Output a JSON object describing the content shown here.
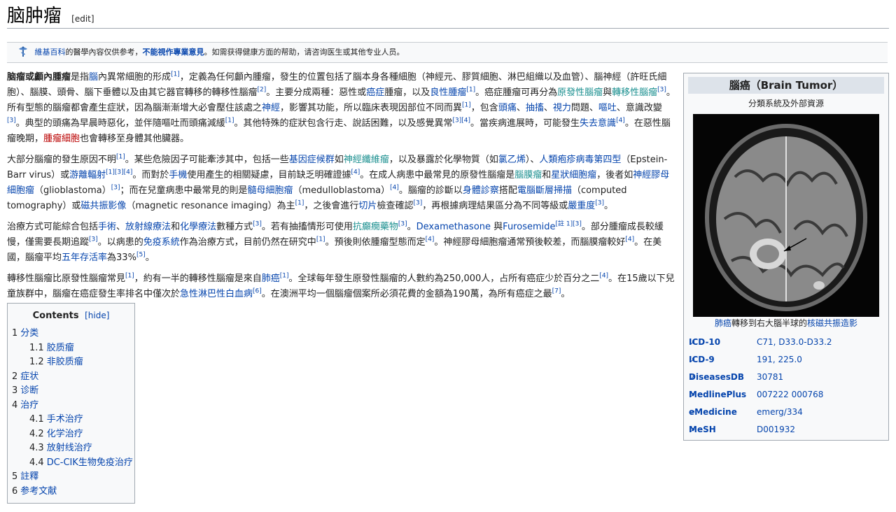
{
  "header": {
    "title": "脑肿瘤",
    "edit": "[edit]"
  },
  "notice": {
    "site": "維基百科",
    "text1": "的醫學內容仅供参考，",
    "bold": "不能視作專業意見",
    "text2": "。如需获得健康方面的帮助，请咨询医生或其他专业人员。"
  },
  "article": {
    "p1": [
      {
        "t": "脑瘤或顱內腫瘤",
        "b": true
      },
      {
        "t": "是指"
      },
      {
        "t": "腦",
        "link": true
      },
      {
        "t": "內異常細胞的形成"
      },
      {
        "t": "[1]",
        "sup": true
      },
      {
        "t": "，定義為任何顱內腫瘤，發生的位置包括了腦本身各種細胞（神經元、膠質細胞、淋巴組織以及血管）、腦神經（許旺氏細胞）、腦膜、頭骨、腦下垂體以及由其它器官轉移的轉移性腦瘤"
      },
      {
        "t": "[2]",
        "sup": true
      },
      {
        "t": "。主要分成兩種：惡性或"
      },
      {
        "t": "癌症",
        "link": true
      },
      {
        "t": "腫瘤，以及"
      },
      {
        "t": "良性腫瘤",
        "link": true
      },
      {
        "t": "[1]",
        "sup": true
      },
      {
        "t": "。癌症腫瘤可再分為"
      },
      {
        "t": "原發性腦瘤",
        "link": true,
        "teal": true
      },
      {
        "t": "與"
      },
      {
        "t": "轉移性腦瘤",
        "link": true,
        "teal": true
      },
      {
        "t": "[3]",
        "sup": true
      },
      {
        "t": "。所有型態的腦瘤都會產生症狀，因為腦漸漸增大必會壓住該處之"
      },
      {
        "t": "神經",
        "link": true
      },
      {
        "t": "，影響其功能，所以臨床表現因部位不同而異"
      },
      {
        "t": "[1]",
        "sup": true
      },
      {
        "t": "，包含"
      },
      {
        "t": "頭痛",
        "link": true
      },
      {
        "t": "、"
      },
      {
        "t": "抽搐",
        "link": true
      },
      {
        "t": "、"
      },
      {
        "t": "視力",
        "link": true
      },
      {
        "t": "問題、"
      },
      {
        "t": "嘔吐",
        "link": true
      },
      {
        "t": "、意識改變"
      },
      {
        "t": "[3]",
        "sup": true
      },
      {
        "t": "。典型的頭痛為早晨時惡化，並伴隨嘔吐而頭痛減緩"
      },
      {
        "t": "[1]",
        "sup": true
      },
      {
        "t": "。其他特殊的症狀包含行走、說話困難，以及感覺異常"
      },
      {
        "t": "[3][4]",
        "sup": true
      },
      {
        "t": "。當疾病進展時，可能發生"
      },
      {
        "t": "失去意識",
        "link": true
      },
      {
        "t": "[4]",
        "sup": true
      },
      {
        "t": "。在惡性腦瘤晚期，"
      },
      {
        "t": "腫瘤細胞",
        "link": true,
        "red": true
      },
      {
        "t": "也會轉移至身體其他臟器。"
      }
    ],
    "p2": [
      {
        "t": "大部分腦瘤的發生原因不明"
      },
      {
        "t": "[1]",
        "sup": true
      },
      {
        "t": "。某些危險因子可能牽涉其中，包括一些"
      },
      {
        "t": "基因症候群",
        "link": true
      },
      {
        "t": "如"
      },
      {
        "t": "神經纖維瘤",
        "link": true,
        "teal": true
      },
      {
        "t": "，以及暴露於化學物質（如"
      },
      {
        "t": "氯乙烯",
        "link": true
      },
      {
        "t": "）、"
      },
      {
        "t": "人類疱疹病毒第四型",
        "link": true
      },
      {
        "t": "（Epstein-Barr virus）或"
      },
      {
        "t": "游離輻射",
        "link": true
      },
      {
        "t": "[1][3][4]",
        "sup": true
      },
      {
        "t": "。而對於"
      },
      {
        "t": "手機",
        "link": true
      },
      {
        "t": "使用產生的相關疑慮，目前缺乏明確證據"
      },
      {
        "t": "[4]",
        "sup": true
      },
      {
        "t": "。在成人病患中最常見的原發性腦瘤是"
      },
      {
        "t": "腦膜瘤",
        "link": true,
        "teal": true
      },
      {
        "t": "和"
      },
      {
        "t": "星狀細胞瘤",
        "link": true
      },
      {
        "t": "，後者如"
      },
      {
        "t": "神經膠母細胞瘤",
        "link": true
      },
      {
        "t": "（glioblastoma）"
      },
      {
        "t": "[3]",
        "sup": true
      },
      {
        "t": "；而在兒童病患中最常見的則是"
      },
      {
        "t": "髓母細胞瘤",
        "link": true
      },
      {
        "t": "（medulloblastoma）"
      },
      {
        "t": "[4]",
        "sup": true
      },
      {
        "t": "。腦瘤的診斷以"
      },
      {
        "t": "身體診察",
        "link": true
      },
      {
        "t": "搭配"
      },
      {
        "t": "電腦斷層掃描",
        "link": true
      },
      {
        "t": "（computed tomography）或"
      },
      {
        "t": "磁共振影像",
        "link": true
      },
      {
        "t": "（magnetic resonance imaging）為主"
      },
      {
        "t": "[1]",
        "sup": true
      },
      {
        "t": "，之後會進行"
      },
      {
        "t": "切片",
        "link": true
      },
      {
        "t": "檢查確認"
      },
      {
        "t": "[3]",
        "sup": true
      },
      {
        "t": "，再根據病理結果區分為不同等級或"
      },
      {
        "t": "嚴重度",
        "link": true
      },
      {
        "t": "[3]",
        "sup": true
      },
      {
        "t": "。"
      }
    ],
    "p3": [
      {
        "t": "治療方式可能綜合包括"
      },
      {
        "t": "手術",
        "link": true
      },
      {
        "t": "、"
      },
      {
        "t": "放射線療法",
        "link": true
      },
      {
        "t": "和"
      },
      {
        "t": "化學療法",
        "link": true
      },
      {
        "t": "數種方式"
      },
      {
        "t": "[3]",
        "sup": true
      },
      {
        "t": "。若有抽搐情形可使用"
      },
      {
        "t": "抗癲癇藥物",
        "link": true,
        "teal": true
      },
      {
        "t": "[3]",
        "sup": true
      },
      {
        "t": "。"
      },
      {
        "t": "Dexamethasone",
        "link": true
      },
      {
        "t": " 與"
      },
      {
        "t": "Furosemide",
        "link": true
      },
      {
        "t": "[註 1][3]",
        "sup": true
      },
      {
        "t": "。部分腫瘤成長較緩慢，僅需要長期追蹤"
      },
      {
        "t": "[3]",
        "sup": true
      },
      {
        "t": "。以病患的"
      },
      {
        "t": "免疫系統",
        "link": true
      },
      {
        "t": "作為治療方式，目前仍然在研究中"
      },
      {
        "t": "[1]",
        "sup": true
      },
      {
        "t": "。預後則依腫瘤型態而定"
      },
      {
        "t": "[4]",
        "sup": true
      },
      {
        "t": "。神經膠母細胞瘤通常預後較差，而腦膜瘤較好"
      },
      {
        "t": "[4]",
        "sup": true
      },
      {
        "t": "。在美國，腦瘤平均"
      },
      {
        "t": "五年存活率",
        "link": true
      },
      {
        "t": "為33%"
      },
      {
        "t": "[5]",
        "sup": true
      },
      {
        "t": "。"
      }
    ],
    "p4": [
      {
        "t": "轉移性腦瘤比原發性腦瘤常見"
      },
      {
        "t": "[1]",
        "sup": true
      },
      {
        "t": "，約有一半的轉移性腦瘤是來自"
      },
      {
        "t": "肺癌",
        "link": true
      },
      {
        "t": "[1]",
        "sup": true
      },
      {
        "t": "。全球每年發生原發性腦瘤的人數約為250,000人，占所有癌症少於百分之二"
      },
      {
        "t": "[4]",
        "sup": true
      },
      {
        "t": "。在15歲以下兒童族群中，腦瘤在癌症發生率排名中僅次於"
      },
      {
        "t": "急性淋巴性白血病",
        "link": true
      },
      {
        "t": "[6]",
        "sup": true
      },
      {
        "t": "。在澳洲平均一個腦瘤個案所必須花費的金額為190萬，為所有癌症之最"
      },
      {
        "t": "[7]",
        "sup": true
      },
      {
        "t": "。"
      }
    ]
  },
  "toc": {
    "title": "Contents",
    "hide": "[hide]",
    "items": [
      {
        "num": "1",
        "label": "分类",
        "level": 1
      },
      {
        "num": "1.1",
        "label": "胶质瘤",
        "level": 2
      },
      {
        "num": "1.2",
        "label": "非胶质瘤",
        "level": 2
      },
      {
        "num": "2",
        "label": "症状",
        "level": 1
      },
      {
        "num": "3",
        "label": "诊断",
        "level": 1
      },
      {
        "num": "4",
        "label": "治疗",
        "level": 1
      },
      {
        "num": "4.1",
        "label": "手术治疗",
        "level": 2
      },
      {
        "num": "4.2",
        "label": "化学治疗",
        "level": 2
      },
      {
        "num": "4.3",
        "label": "放射线治疗",
        "level": 2
      },
      {
        "num": "4.4",
        "label": "DC-CIK生物免疫治疗",
        "level": 2
      },
      {
        "num": "5",
        "label": "註釋",
        "level": 1
      },
      {
        "num": "6",
        "label": "参考文献",
        "level": 1
      }
    ]
  },
  "infobox": {
    "title": "腦癌（Brain Tumor）",
    "subtitle": "分類系統及外部資源",
    "caption_link1": "肺癌",
    "caption_mid": "轉移到右大腦半球的",
    "caption_link2": "核磁共振造影",
    "rows": [
      {
        "key": "ICD-10",
        "value": "C71, D33.0-D33.2"
      },
      {
        "key": "ICD-9",
        "value": "191, 225.0"
      },
      {
        "key": "DiseasesDB",
        "value": "30781"
      },
      {
        "key": "MedlinePlus",
        "value": "007222 000768"
      },
      {
        "key": "eMedicine",
        "value": "emerg/334"
      },
      {
        "key": "MeSH",
        "value": "D001932"
      }
    ]
  },
  "icons": {
    "notice": "caduceus-icon",
    "external": "external-link-icon"
  }
}
